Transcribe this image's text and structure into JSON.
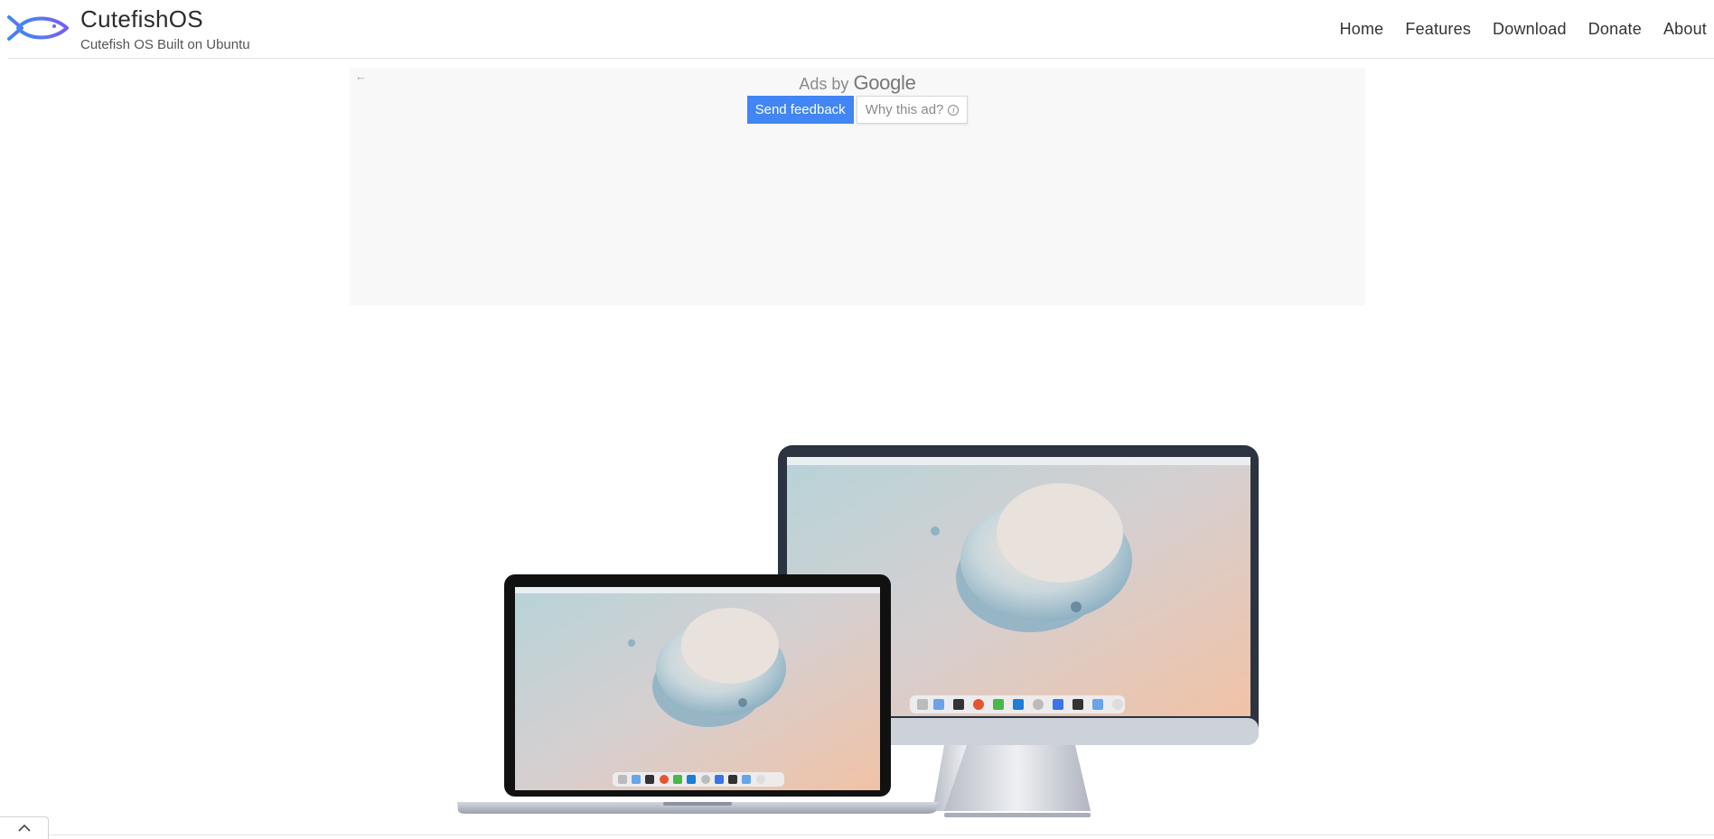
{
  "brand": {
    "title": "CutefishOS",
    "subtitle": "Cutefish OS Built on Ubuntu",
    "logo_icon": "fish-logo-icon"
  },
  "nav": {
    "items": [
      {
        "label": "Home"
      },
      {
        "label": "Features"
      },
      {
        "label": "Download"
      },
      {
        "label": "Donate"
      },
      {
        "label": "About"
      }
    ]
  },
  "ad": {
    "ads_by": "Ads by",
    "google": "Google",
    "send_feedback": "Send feedback",
    "why_this_ad": "Why this ad?",
    "back_icon": "arrow-left-icon",
    "info_icon": "info-icon"
  },
  "hero": {
    "devices": [
      "laptop",
      "desktop-monitor"
    ]
  },
  "scroll_top": {
    "icon": "chevron-up-icon"
  },
  "colors": {
    "accent": "#4285f4",
    "logo_blue": "#3d7cf0",
    "logo_purple": "#7a5cf0"
  }
}
